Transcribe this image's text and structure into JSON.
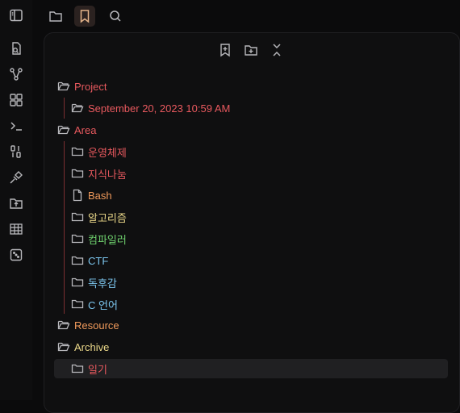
{
  "ribbon": {
    "icons": [
      "open-switcher-icon",
      "graph-view-icon",
      "canvas-icon",
      "command-palette-icon",
      "binary-icon",
      "plugin-icon",
      "upload-folder-icon",
      "table-icon",
      "random-note-icon"
    ]
  },
  "tabs": [
    "files-tab",
    "bookmarks-tab",
    "search-tab"
  ],
  "toolbar": [
    "bookmark-current-icon",
    "new-group-icon",
    "collapse-all-icon"
  ],
  "colors": {
    "red": "#e8595e",
    "orange": "#f09a5b",
    "yellow": "#ecd98a",
    "green": "#6fd26e",
    "blue": "#7cc6ee",
    "guide_red": "#7a2f31",
    "guide_yellow": "#8a7a3a"
  },
  "tree": {
    "project": {
      "label": "Project",
      "child": "September 20, 2023 10:59 AM"
    },
    "area": {
      "label": "Area",
      "children": [
        "운영체제",
        "지식나눔",
        "Bash",
        "알고리즘",
        "컴파일러",
        "CTF",
        "독후감",
        "C 언어"
      ]
    },
    "resource": {
      "label": "Resource"
    },
    "archive": {
      "label": "Archive",
      "child": "일기"
    }
  }
}
